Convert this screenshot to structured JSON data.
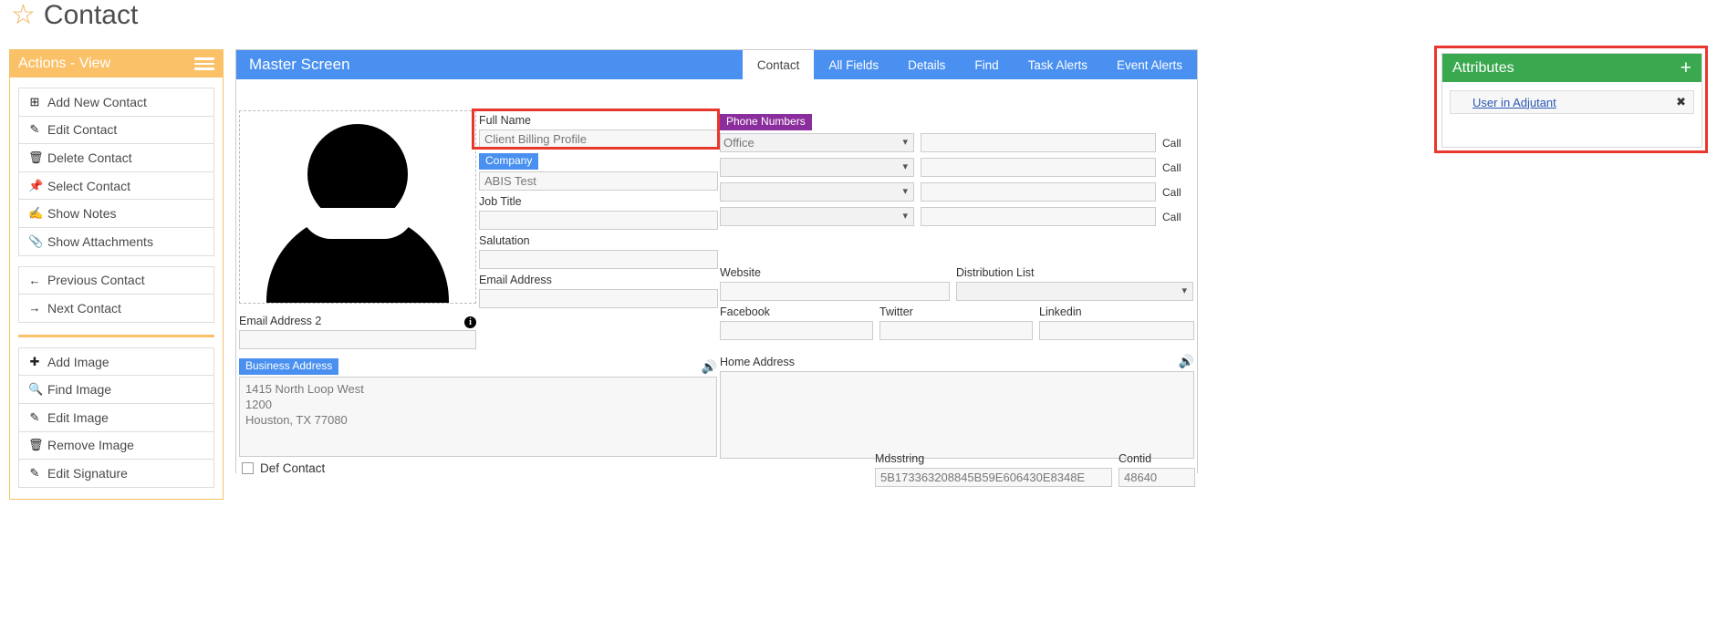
{
  "page": {
    "title": "Contact",
    "star_icon": "star-outline-icon"
  },
  "sidebar": {
    "header": "Actions - View",
    "menu_icon": "hamburger-menu-icon",
    "groups": [
      {
        "items": [
          {
            "label": "Add New Contact",
            "icon": "plus-square-icon",
            "glyph": "⊞"
          },
          {
            "label": "Edit Contact",
            "icon": "pencil-icon",
            "glyph": "✎"
          },
          {
            "label": "Delete Contact",
            "icon": "trash-icon",
            "glyph": "🗑"
          },
          {
            "label": "Select Contact",
            "icon": "thumbtack-icon",
            "glyph": "📌"
          },
          {
            "label": "Show Notes",
            "icon": "edit-square-icon",
            "glyph": "✍"
          },
          {
            "label": "Show Attachments",
            "icon": "paperclip-icon",
            "glyph": "📎"
          }
        ]
      },
      {
        "items": [
          {
            "label": "Previous Contact",
            "icon": "arrow-left-icon",
            "glyph": "←"
          },
          {
            "label": "Next Contact",
            "icon": "arrow-right-icon",
            "glyph": "→"
          }
        ]
      },
      {
        "items": [
          {
            "label": "Add Image",
            "icon": "plus-icon",
            "glyph": "✚"
          },
          {
            "label": "Find Image",
            "icon": "search-icon",
            "glyph": "🔍"
          },
          {
            "label": "Edit Image",
            "icon": "pencil-icon",
            "glyph": "✎"
          },
          {
            "label": "Remove Image",
            "icon": "trash-icon",
            "glyph": "🗑"
          },
          {
            "label": "Edit Signature",
            "icon": "pencil-icon",
            "glyph": "✎"
          }
        ]
      }
    ]
  },
  "main": {
    "title": "Master Screen",
    "tabs": [
      {
        "label": "Contact",
        "active": true
      },
      {
        "label": "All Fields",
        "active": false
      },
      {
        "label": "Details",
        "active": false
      },
      {
        "label": "Find",
        "active": false
      },
      {
        "label": "Task Alerts",
        "active": false
      },
      {
        "label": "Event Alerts",
        "active": false
      }
    ],
    "photo": {
      "icon": "user-avatar-placeholder-icon"
    },
    "fields": {
      "full_name": {
        "label": "Full Name",
        "value": "Client Billing Profile",
        "highlighted": true
      },
      "company": {
        "label": "Company",
        "value": "ABIS Test",
        "badge": "blue"
      },
      "job_title": {
        "label": "Job Title",
        "value": ""
      },
      "salutation": {
        "label": "Salutation",
        "value": ""
      },
      "email": {
        "label": "Email Address",
        "value": ""
      },
      "email2": {
        "label": "Email Address 2",
        "value": "",
        "info_icon": "info-circle-icon"
      },
      "website": {
        "label": "Website",
        "value": ""
      },
      "distribution_list": {
        "label": "Distribution List",
        "value": ""
      },
      "facebook": {
        "label": "Facebook",
        "value": ""
      },
      "twitter": {
        "label": "Twitter",
        "value": ""
      },
      "linkedin": {
        "label": "Linkedin",
        "value": ""
      },
      "mdsstring": {
        "label": "Mdsstring",
        "value": "5B173363208845B59E606430E8348E"
      },
      "contid": {
        "label": "Contid",
        "value": "48640"
      }
    },
    "phone_numbers": {
      "badge_label": "Phone Numbers",
      "call_label": "Call",
      "rows": [
        {
          "type": "Office",
          "number": ""
        },
        {
          "type": "",
          "number": ""
        },
        {
          "type": "",
          "number": ""
        },
        {
          "type": "",
          "number": ""
        }
      ]
    },
    "business_address": {
      "badge_label": "Business Address",
      "speaker_icon": "speaker-icon",
      "value": "1415 North Loop West\n1200\nHouston, TX 77080"
    },
    "home_address": {
      "label": "Home Address",
      "speaker_icon": "speaker-icon",
      "value": ""
    },
    "def_contact": {
      "label": "Def Contact",
      "checked": false
    }
  },
  "attributes": {
    "header": "Attributes",
    "add_icon": "plus-icon",
    "items": [
      {
        "label": "User in Adjutant",
        "remove_icon": "close-icon",
        "remove_glyph": "✖"
      }
    ]
  },
  "colors": {
    "accent_orange": "#fbc168",
    "accent_blue": "#4a90f0",
    "accent_green": "#3aa84e",
    "accent_purple": "#8b2d9c",
    "highlight_red": "#e8372c"
  }
}
